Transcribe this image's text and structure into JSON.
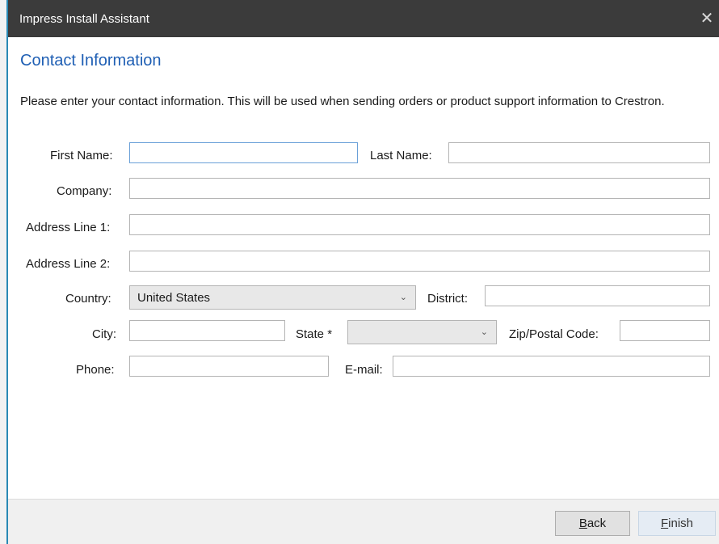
{
  "window": {
    "title": "Impress Install Assistant",
    "close_glyph": "✕"
  },
  "page": {
    "heading": "Contact Information",
    "intro": "Please enter your contact information. This will be used when sending orders or product support information to Crestron."
  },
  "form": {
    "first_name": {
      "label": "First Name:",
      "value": ""
    },
    "last_name": {
      "label": "Last Name:",
      "value": ""
    },
    "company": {
      "label": "Company:",
      "value": ""
    },
    "address1": {
      "label": "Address Line 1:",
      "value": ""
    },
    "address2": {
      "label": "Address Line 2:",
      "value": ""
    },
    "country": {
      "label": "Country:",
      "value": "United States"
    },
    "district": {
      "label": "District:",
      "value": ""
    },
    "city": {
      "label": "City:",
      "value": ""
    },
    "state": {
      "label": "State *",
      "value": ""
    },
    "zip": {
      "label": "Zip/Postal Code:",
      "value": ""
    },
    "phone": {
      "label": "Phone:",
      "value": ""
    },
    "email": {
      "label": "E-mail:",
      "value": ""
    }
  },
  "footer": {
    "back_accel": "B",
    "back_rest": "ack",
    "finish_accel": "F",
    "finish_rest": "inish"
  },
  "colors": {
    "titlebar": "#3b3b3b",
    "heading": "#1f5fb4",
    "accent_border": "#2a8ab5"
  },
  "icons": {
    "close": "close-icon",
    "dropdown": "chevron-down-icon"
  }
}
